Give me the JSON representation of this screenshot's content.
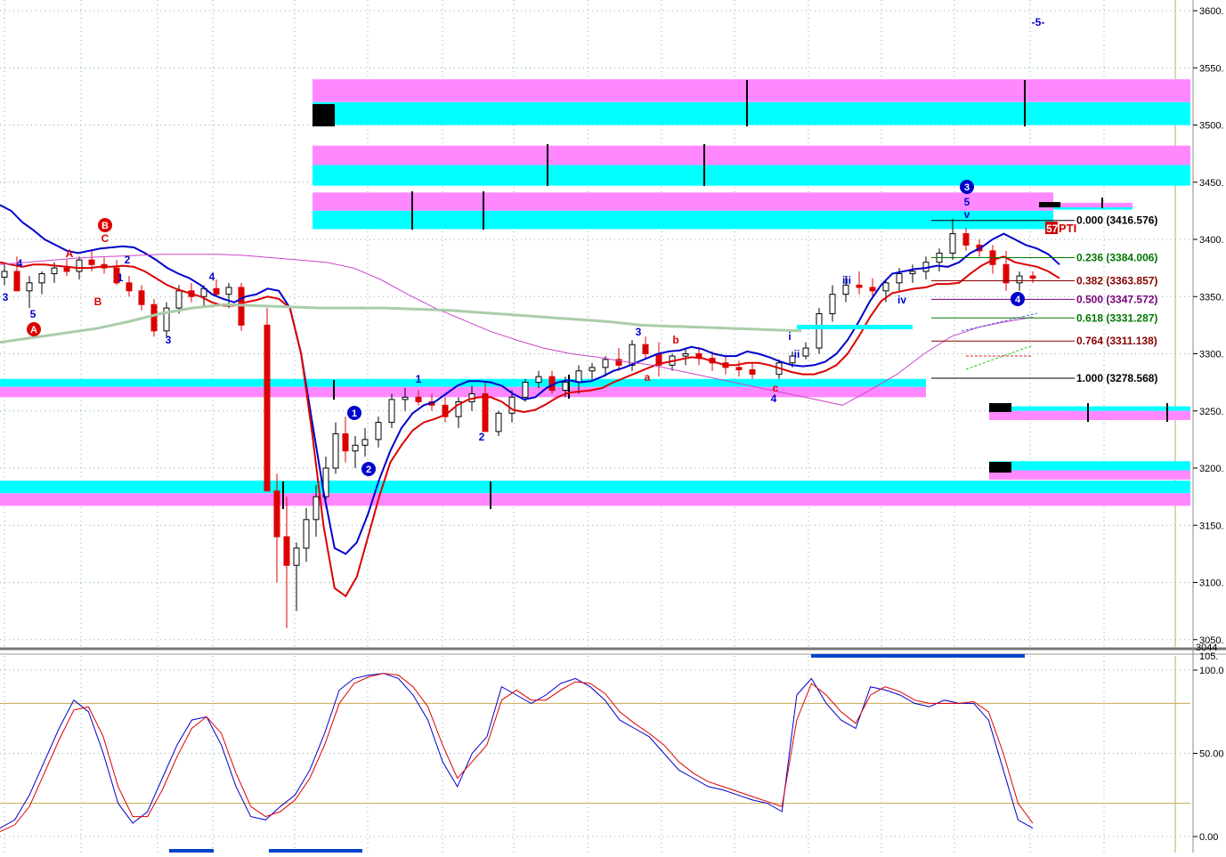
{
  "chart_data": [
    {
      "type": "candlestick",
      "panel": "price",
      "title": "",
      "y_axis_ticks": [
        3600,
        3550,
        3500,
        3450,
        3400,
        3350,
        3300,
        3250,
        3200,
        3150,
        3100,
        3050
      ],
      "y_tick_labels": [
        "3600.",
        "3550.",
        "3500.",
        "3450.",
        "3400.",
        "3350.",
        "3300.",
        "3250.",
        "3200.",
        "3150.",
        "3100.",
        "3050."
      ],
      "bottom_readout": "3044",
      "grid": true,
      "price_bands": [
        {
          "top": 3540,
          "mid": 3520,
          "bottom": 3500,
          "x_start": 351,
          "x_end": 1337
        },
        {
          "top": 3482,
          "mid": 3465,
          "bottom": 3447,
          "x_start": 351,
          "x_end": 1337
        },
        {
          "top": 3441,
          "mid": 3425,
          "bottom": 3409,
          "x_start": 351,
          "x_end": 1183
        },
        {
          "top": 3432,
          "mid": 3428,
          "bottom": 3426,
          "x_start": 1183,
          "x_end": 1272
        },
        {
          "top": 3278,
          "mid": 3271,
          "bottom": 3262,
          "x_start": 0,
          "x_end": 1040
        },
        {
          "top": 3189,
          "mid": 3178,
          "bottom": 3167,
          "x_start": 0,
          "x_end": 1337
        },
        {
          "top": 3254,
          "mid": 3250,
          "bottom": 3242,
          "x_start": 1111,
          "x_end": 1337
        },
        {
          "top": 3206,
          "mid": 3198,
          "bottom": 3190,
          "x_start": 1111,
          "x_end": 1337
        }
      ],
      "wave_labels": [
        {
          "text": "4",
          "color": "#0000cc"
        },
        {
          "text": "3",
          "color": "#0000cc"
        },
        {
          "text": "5",
          "color": "#0000cc"
        },
        {
          "text": "A",
          "color": "#dd0000"
        },
        {
          "text": "B",
          "color": "#dd0000"
        },
        {
          "text": "C",
          "color": "#dd0000"
        },
        {
          "text": "A",
          "color": "#dd0000"
        },
        {
          "text": "B",
          "color": "#dd0000"
        },
        {
          "text": "2",
          "color": "#0000cc"
        },
        {
          "text": "1",
          "color": "#0000cc"
        },
        {
          "text": "3",
          "color": "#0000cc"
        },
        {
          "text": "4",
          "color": "#0000cc"
        },
        {
          "text": "1",
          "color": "#0000cc"
        },
        {
          "text": "2",
          "color": "#0000cc"
        },
        {
          "text": "1",
          "color": "#0000cc"
        },
        {
          "text": "2",
          "color": "#0000cc"
        },
        {
          "text": "3",
          "color": "#0000cc"
        },
        {
          "text": "a",
          "color": "#dd0000"
        },
        {
          "text": "b",
          "color": "#dd0000"
        },
        {
          "text": "c",
          "color": "#dd0000"
        },
        {
          "text": "4",
          "color": "#0000cc"
        },
        {
          "text": "i",
          "color": "#0000cc"
        },
        {
          "text": "ii",
          "color": "#0000cc"
        },
        {
          "text": "iii",
          "color": "#0000cc"
        },
        {
          "text": "iv",
          "color": "#0000cc"
        },
        {
          "text": "3",
          "color": "#0000cc"
        },
        {
          "text": "5",
          "color": "#0000cc"
        },
        {
          "text": "v",
          "color": "#0000cc"
        },
        {
          "text": "4",
          "color": "#0000cc"
        },
        {
          "text": "-5-",
          "color": "#0000cc"
        }
      ],
      "pti_badge": {
        "number": "57",
        "text": "PTI",
        "color": "#cc0000"
      },
      "fibonacci": [
        {
          "ratio": "0.000",
          "price": "(3416.576)",
          "value": 3416.576,
          "color": "#000000"
        },
        {
          "ratio": "0.236",
          "price": "(3384.006)",
          "value": 3384.006,
          "color": "#007700"
        },
        {
          "ratio": "0.382",
          "price": "(3363.857)",
          "value": 3363.857,
          "color": "#880000"
        },
        {
          "ratio": "0.500",
          "price": "(3347.572)",
          "value": 3347.572,
          "color": "#770077"
        },
        {
          "ratio": "0.618",
          "price": "(3331.287)",
          "value": 3331.287,
          "color": "#007700"
        },
        {
          "ratio": "0.764",
          "price": "(3311.138)",
          "value": 3311.138,
          "color": "#880000"
        },
        {
          "ratio": "1.000",
          "price": "(3278.568)",
          "value": 3278.568,
          "color": "#000000"
        }
      ],
      "series": [
        {
          "name": "",
          "color": "#0000cc",
          "values": [
            3430,
            3425,
            3415,
            3408,
            3400,
            3395,
            3390,
            3388,
            3390,
            3392,
            3393,
            3394,
            3393,
            3388,
            3382,
            3375,
            3370,
            3366,
            3360,
            3352,
            3348,
            3345,
            3350,
            3352,
            3357,
            3355,
            3340,
            3300,
            3240,
            3180,
            3130,
            3125,
            3135,
            3160,
            3190,
            3215,
            3235,
            3248,
            3255,
            3258,
            3265,
            3272,
            3276,
            3276,
            3275,
            3272,
            3265,
            3260,
            3262,
            3270,
            3275,
            3277,
            3275,
            3276,
            3280,
            3285,
            3288,
            3292,
            3296,
            3300,
            3302,
            3303,
            3306,
            3304,
            3300,
            3298,
            3298,
            3302,
            3300,
            3297,
            3293,
            3290,
            3289,
            3290,
            3293,
            3300,
            3312,
            3328,
            3346,
            3360,
            3370,
            3372,
            3374,
            3375,
            3377,
            3376,
            3380,
            3388,
            3393,
            3400,
            3405,
            3400,
            3395,
            3392,
            3387,
            3378
          ]
        },
        {
          "name": "",
          "color": "#dd0000",
          "values": [
            3380,
            3378,
            3376,
            3378,
            3378,
            3377,
            3376,
            3375,
            3375,
            3376,
            3376,
            3377,
            3376,
            3372,
            3366,
            3360,
            3356,
            3353,
            3350,
            3345,
            3342,
            3342,
            3345,
            3347,
            3350,
            3348,
            3340,
            3300,
            3230,
            3150,
            3095,
            3088,
            3105,
            3140,
            3175,
            3205,
            3220,
            3233,
            3240,
            3243,
            3247,
            3255,
            3260,
            3262,
            3262,
            3258,
            3251,
            3249,
            3251,
            3256,
            3262,
            3266,
            3267,
            3268,
            3270,
            3275,
            3279,
            3283,
            3287,
            3291,
            3293,
            3295,
            3297,
            3296,
            3293,
            3290,
            3290,
            3292,
            3292,
            3290,
            3287,
            3284,
            3282,
            3282,
            3285,
            3290,
            3300,
            3315,
            3332,
            3346,
            3353,
            3355,
            3357,
            3358,
            3361,
            3361,
            3362,
            3370,
            3377,
            3382,
            3385,
            3380,
            3378,
            3376,
            3372,
            3366
          ]
        },
        {
          "name": "",
          "color": "#cc44cc",
          "values": [
            3378,
            3380,
            3382,
            3384,
            3385,
            3386,
            3387,
            3387,
            3387,
            3386,
            3384,
            3382,
            3380,
            3375,
            3365,
            3352,
            3340,
            3330,
            3320,
            3312,
            3305,
            3300,
            3297,
            3293,
            3290,
            3285,
            3280,
            3275,
            3270,
            3265,
            3260,
            3255,
            3268,
            3282,
            3300,
            3315,
            3323,
            3328,
            3332
          ]
        },
        {
          "name": "",
          "color": "#aaccaa",
          "values": [
            3310,
            3314,
            3318,
            3322,
            3328,
            3335,
            3340,
            3343,
            3342,
            3341,
            3340,
            3340,
            3340,
            3339,
            3338,
            3336,
            3334,
            3332,
            3330,
            3328,
            3325,
            3324,
            3323,
            3322,
            3321,
            3320
          ]
        }
      ],
      "candles": [
        [
          3367,
          3378,
          3360,
          3372
        ],
        [
          3372,
          3385,
          3365,
          3355
        ],
        [
          3355,
          3368,
          3340,
          3362
        ],
        [
          3362,
          3372,
          3352,
          3370
        ],
        [
          3370,
          3380,
          3362,
          3375
        ],
        [
          3375,
          3383,
          3368,
          3372
        ],
        [
          3372,
          3385,
          3365,
          3382
        ],
        [
          3382,
          3390,
          3372,
          3378
        ],
        [
          3378,
          3384,
          3370,
          3375
        ],
        [
          3375,
          3382,
          3360,
          3362
        ],
        [
          3362,
          3368,
          3350,
          3355
        ],
        [
          3355,
          3360,
          3338,
          3343
        ],
        [
          3343,
          3348,
          3315,
          3320
        ],
        [
          3320,
          3345,
          3315,
          3340
        ],
        [
          3340,
          3360,
          3335,
          3355
        ],
        [
          3355,
          3362,
          3345,
          3350
        ],
        [
          3350,
          3360,
          3342,
          3357
        ],
        [
          3357,
          3365,
          3350,
          3352
        ],
        [
          3352,
          3362,
          3340,
          3358
        ],
        [
          3358,
          3362,
          3320,
          3325
        ],
        [
          3325,
          3340,
          3218,
          3180
        ],
        [
          3180,
          3195,
          3100,
          3140
        ],
        [
          3140,
          3175,
          3060,
          3115
        ],
        [
          3115,
          3135,
          3075,
          3130
        ],
        [
          3130,
          3165,
          3118,
          3155
        ],
        [
          3155,
          3185,
          3140,
          3175
        ],
        [
          3175,
          3210,
          3165,
          3200
        ],
        [
          3200,
          3240,
          3195,
          3230
        ],
        [
          3230,
          3245,
          3205,
          3215
        ],
        [
          3215,
          3228,
          3200,
          3220
        ],
        [
          3220,
          3235,
          3210,
          3225
        ],
        [
          3225,
          3245,
          3218,
          3240
        ],
        [
          3240,
          3265,
          3235,
          3260
        ],
        [
          3260,
          3270,
          3250,
          3262
        ],
        [
          3262,
          3268,
          3255,
          3258
        ],
        [
          3258,
          3265,
          3250,
          3255
        ],
        [
          3255,
          3262,
          3240,
          3245
        ],
        [
          3245,
          3262,
          3235,
          3258
        ],
        [
          3258,
          3272,
          3250,
          3265
        ],
        [
          3265,
          3275,
          3240,
          3232
        ],
        [
          3232,
          3250,
          3228,
          3248
        ],
        [
          3248,
          3268,
          3240,
          3262
        ],
        [
          3262,
          3278,
          3258,
          3275
        ],
        [
          3275,
          3285,
          3270,
          3280
        ],
        [
          3280,
          3285,
          3265,
          3268
        ],
        [
          3268,
          3280,
          3262,
          3275
        ],
        [
          3275,
          3290,
          3265,
          3285
        ],
        [
          3285,
          3292,
          3278,
          3288
        ],
        [
          3288,
          3298,
          3280,
          3295
        ],
        [
          3295,
          3305,
          3285,
          3290
        ],
        [
          3290,
          3312,
          3285,
          3308
        ],
        [
          3308,
          3315,
          3295,
          3300
        ],
        [
          3300,
          3310,
          3280,
          3290
        ],
        [
          3290,
          3300,
          3285,
          3298
        ],
        [
          3298,
          3305,
          3290,
          3300
        ],
        [
          3300,
          3306,
          3290,
          3296
        ],
        [
          3296,
          3302,
          3285,
          3292
        ],
        [
          3292,
          3298,
          3282,
          3288
        ],
        [
          3288,
          3294,
          3280,
          3286
        ],
        [
          3286,
          3292,
          3278,
          3282
        ],
        [
          3282,
          3295,
          3278,
          3292
        ],
        [
          3292,
          3302,
          3288,
          3298
        ],
        [
          3298,
          3310,
          3295,
          3305
        ],
        [
          3305,
          3340,
          3300,
          3335
        ],
        [
          3335,
          3360,
          3328,
          3352
        ],
        [
          3352,
          3368,
          3345,
          3360
        ],
        [
          3360,
          3372,
          3352,
          3358
        ],
        [
          3358,
          3366,
          3350,
          3355
        ],
        [
          3355,
          3365,
          3345,
          3362
        ],
        [
          3362,
          3375,
          3355,
          3370
        ],
        [
          3370,
          3378,
          3362,
          3372
        ],
        [
          3372,
          3385,
          3365,
          3380
        ],
        [
          3380,
          3392,
          3372,
          3388
        ],
        [
          3388,
          3418,
          3382,
          3405
        ],
        [
          3405,
          3410,
          3390,
          3395
        ],
        [
          3395,
          3400,
          3385,
          3390
        ],
        [
          3390,
          3395,
          3370,
          3378
        ],
        [
          3378,
          3390,
          3355,
          3362
        ],
        [
          3362,
          3372,
          3355,
          3368
        ],
        [
          3368,
          3372,
          3362,
          3366
        ]
      ]
    },
    {
      "type": "line",
      "panel": "oscillator",
      "y_axis_ticks": [
        100,
        50,
        0
      ],
      "y_tick_labels": [
        "100.0",
        "50.00",
        "0.00"
      ],
      "top_readout": "105.",
      "reference_lines": [
        80,
        20
      ],
      "series": [
        {
          "name": "",
          "color": "#0000cc",
          "values": [
            5,
            10,
            25,
            45,
            65,
            82,
            75,
            50,
            20,
            8,
            15,
            35,
            55,
            70,
            72,
            55,
            30,
            12,
            10,
            18,
            25,
            40,
            62,
            88,
            95,
            97,
            98,
            95,
            85,
            70,
            45,
            30,
            50,
            60,
            90,
            85,
            80,
            85,
            92,
            95,
            90,
            82,
            70,
            65,
            60,
            50,
            40,
            35,
            30,
            28,
            25,
            22,
            20,
            15,
            85,
            95,
            80,
            70,
            65,
            90,
            88,
            85,
            80,
            78,
            82,
            80,
            80,
            70,
            40,
            10,
            5
          ]
        },
        {
          "name": "",
          "color": "#dd0000",
          "values": [
            3,
            7,
            18,
            38,
            58,
            76,
            78,
            60,
            30,
            12,
            12,
            28,
            48,
            65,
            72,
            62,
            38,
            18,
            12,
            15,
            22,
            35,
            55,
            80,
            92,
            96,
            98,
            97,
            90,
            78,
            55,
            35,
            45,
            55,
            82,
            88,
            82,
            82,
            88,
            93,
            92,
            86,
            75,
            68,
            62,
            55,
            45,
            38,
            33,
            30,
            27,
            24,
            21,
            18,
            70,
            92,
            85,
            75,
            68,
            85,
            90,
            87,
            82,
            80,
            80,
            80,
            81,
            75,
            50,
            20,
            8
          ]
        }
      ]
    }
  ]
}
